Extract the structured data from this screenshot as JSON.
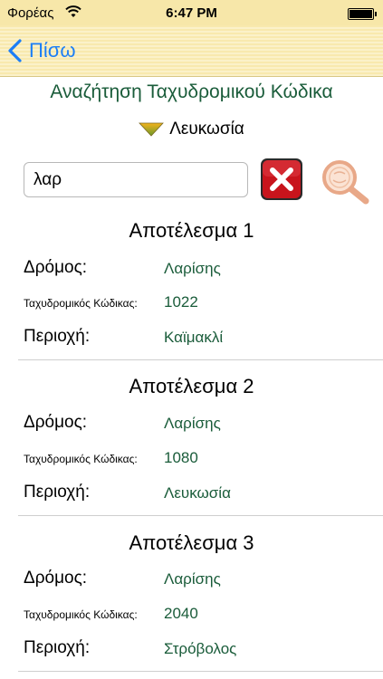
{
  "status_bar": {
    "carrier": "Φορέας",
    "time": "6:47 PM"
  },
  "nav": {
    "back_label": "Πίσω"
  },
  "page": {
    "title": "Αναζήτηση Ταχυδρομικού Κώδικα"
  },
  "region": {
    "selected": "Λευκωσία"
  },
  "search": {
    "value": "λαρ",
    "placeholder": ""
  },
  "labels": {
    "street": "Δρόμος:",
    "postal_code": "Ταχυδρομικός Κώδικας:",
    "area": "Περιοχή:"
  },
  "results": [
    {
      "heading": "Αποτέλεσμα 1",
      "street": "Λαρίσης",
      "postal_code": "1022",
      "area": "Καϊμακλί"
    },
    {
      "heading": "Αποτέλεσμα 2",
      "street": "Λαρίσης",
      "postal_code": "1080",
      "area": "Λευκωσία"
    },
    {
      "heading": "Αποτέλεσμα 3",
      "street": "Λαρίσης",
      "postal_code": "2040",
      "area": "Στρόβολος"
    }
  ],
  "colors": {
    "accent_text": "#1a5c3a",
    "nav_link": "#1b7ef6",
    "nav_bar": "#f8e9ae",
    "clear_button": "#c8141c"
  },
  "icons": {
    "back": "chevron-left-icon",
    "region": "dropdown-triangle-icon",
    "clear": "clear-x-icon",
    "search": "magnifier-icon"
  }
}
